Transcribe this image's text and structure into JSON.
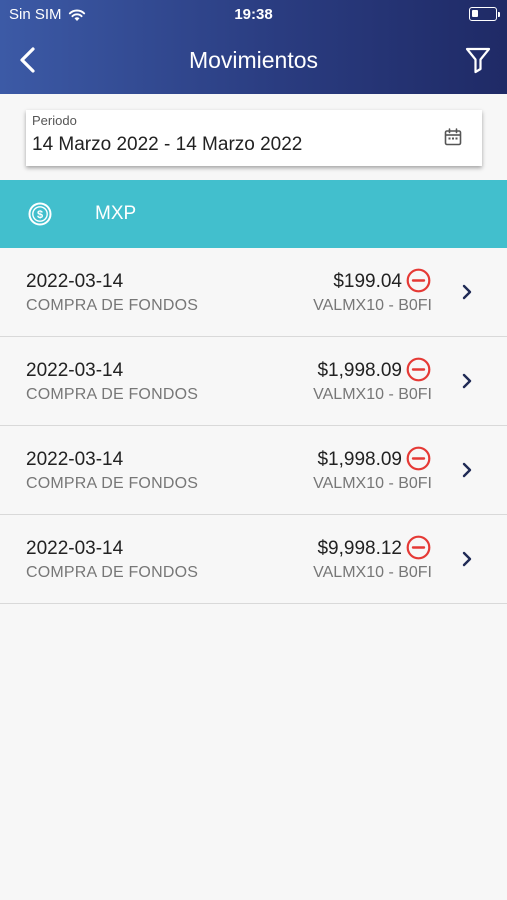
{
  "status_bar": {
    "carrier": "Sin SIM",
    "time": "19:38",
    "wifi_icon": "wifi-icon",
    "battery_icon": "battery-icon"
  },
  "nav": {
    "title": "Movimientos",
    "back_icon": "chevron-left-icon",
    "filter_icon": "filter-funnel-icon"
  },
  "period": {
    "label": "Periodo",
    "value": "14 Marzo 2022 - 14 Marzo 2022",
    "icon": "calendar-icon"
  },
  "currency": {
    "label": "MXP",
    "icon": "dollar-coin-icon"
  },
  "transactions": [
    {
      "date": "2022-03-14",
      "type": "COMPRA DE FONDOS",
      "amount": "$199.04",
      "fund": "VALMX10 - B0FI"
    },
    {
      "date": "2022-03-14",
      "type": "COMPRA DE FONDOS",
      "amount": "$1,998.09",
      "fund": "VALMX10 - B0FI"
    },
    {
      "date": "2022-03-14",
      "type": "COMPRA DE FONDOS",
      "amount": "$1,998.09",
      "fund": "VALMX10 - B0FI"
    },
    {
      "date": "2022-03-14",
      "type": "COMPRA DE FONDOS",
      "amount": "$9,998.12",
      "fund": "VALMX10 - B0FI"
    }
  ],
  "colors": {
    "header_start": "#3c5aa6",
    "header_end": "#1f2a66",
    "currency_bar": "#42bfcd",
    "negative_indicator": "#e53935"
  }
}
